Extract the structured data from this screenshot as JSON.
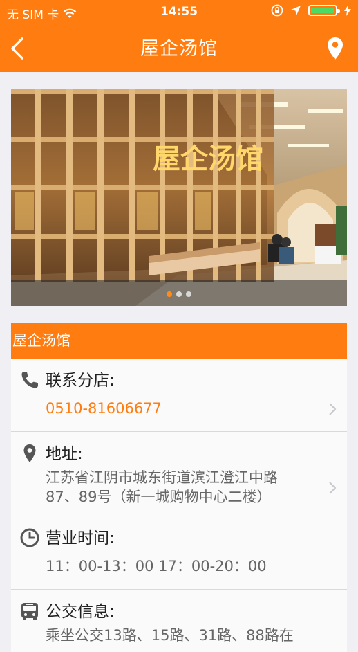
{
  "status_bar": {
    "carrier": "无 SIM 卡",
    "time": "14:55"
  },
  "nav": {
    "title": "屋企汤馆"
  },
  "banner": {
    "signage": "屋企汤馆",
    "page_count": 3,
    "active_page": 1
  },
  "section": {
    "title": "屋企汤馆"
  },
  "rows": {
    "phone": {
      "label": "联系分店:",
      "value": "0510-81606677"
    },
    "address": {
      "label": "地址:",
      "line1": "江苏省江阴市城东街道滨江澄江中路",
      "line2": "87、89号（新一城购物中心二楼）"
    },
    "hours": {
      "label": "营业时间:",
      "value": "11：00-13：00 17：00-20：00"
    },
    "bus": {
      "label": "公交信息:",
      "value": "乘坐公交13路、15路、31路、88路在"
    }
  },
  "colors": {
    "accent": "#ff7d10",
    "background": "#efeff4",
    "battery": "#4cd964"
  }
}
